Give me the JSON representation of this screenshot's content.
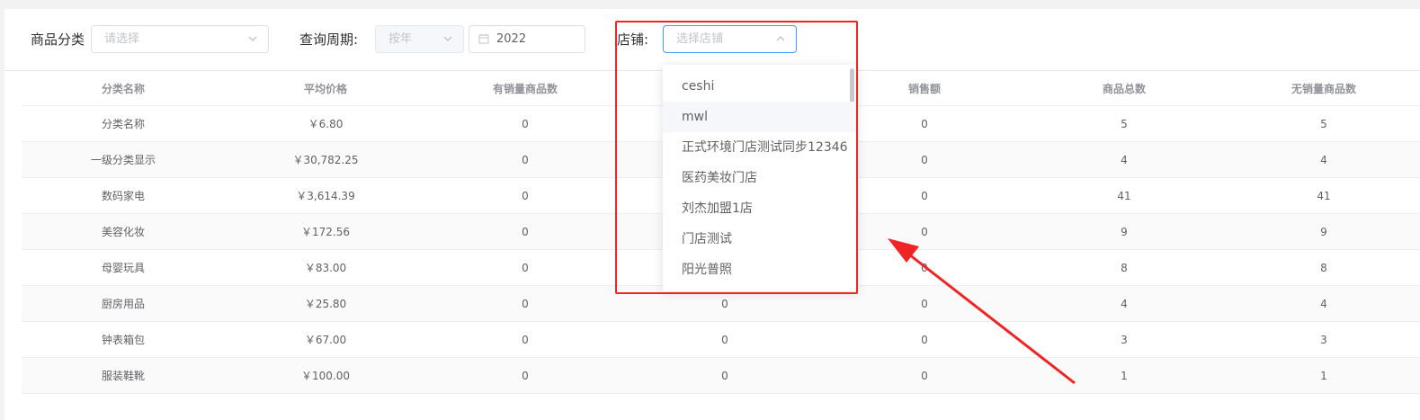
{
  "filters": {
    "category_label": "商品分类",
    "category_placeholder": "请选择",
    "period_label": "查询周期:",
    "period_type": "按年",
    "year_value": "2022",
    "store_label": "店铺:",
    "store_placeholder": "选择店铺"
  },
  "table": {
    "columns": [
      "分类名称",
      "平均价格",
      "有销量商品数",
      "",
      "销售额",
      "商品总数",
      "无销量商品数"
    ],
    "rows": [
      [
        "分类名称",
        "￥6.80",
        "0",
        "",
        "0",
        "5",
        "5"
      ],
      [
        "一级分类显示",
        "￥30,782.25",
        "0",
        "",
        "0",
        "4",
        "4"
      ],
      [
        "数码家电",
        "￥3,614.39",
        "0",
        "",
        "0",
        "41",
        "41"
      ],
      [
        "美容化妆",
        "￥172.56",
        "0",
        "",
        "0",
        "9",
        "9"
      ],
      [
        "母婴玩具",
        "￥83.00",
        "0",
        "",
        "0",
        "8",
        "8"
      ],
      [
        "厨房用品",
        "￥25.80",
        "0",
        "0",
        "0",
        "4",
        "4"
      ],
      [
        "钟表箱包",
        "￥67.00",
        "0",
        "0",
        "0",
        "3",
        "3"
      ],
      [
        "服装鞋靴",
        "￥100.00",
        "0",
        "0",
        "0",
        "1",
        "1"
      ]
    ]
  },
  "store_dropdown": {
    "options": [
      "ceshi",
      "mwl",
      "正式环境门店测试同步12346",
      "医药美妆门店",
      "刘杰加盟1店",
      "门店测试",
      "阳光普照"
    ],
    "hovered_index": 1
  },
  "colors": {
    "highlight_red": "#f02424",
    "focus_blue": "#409eff"
  }
}
